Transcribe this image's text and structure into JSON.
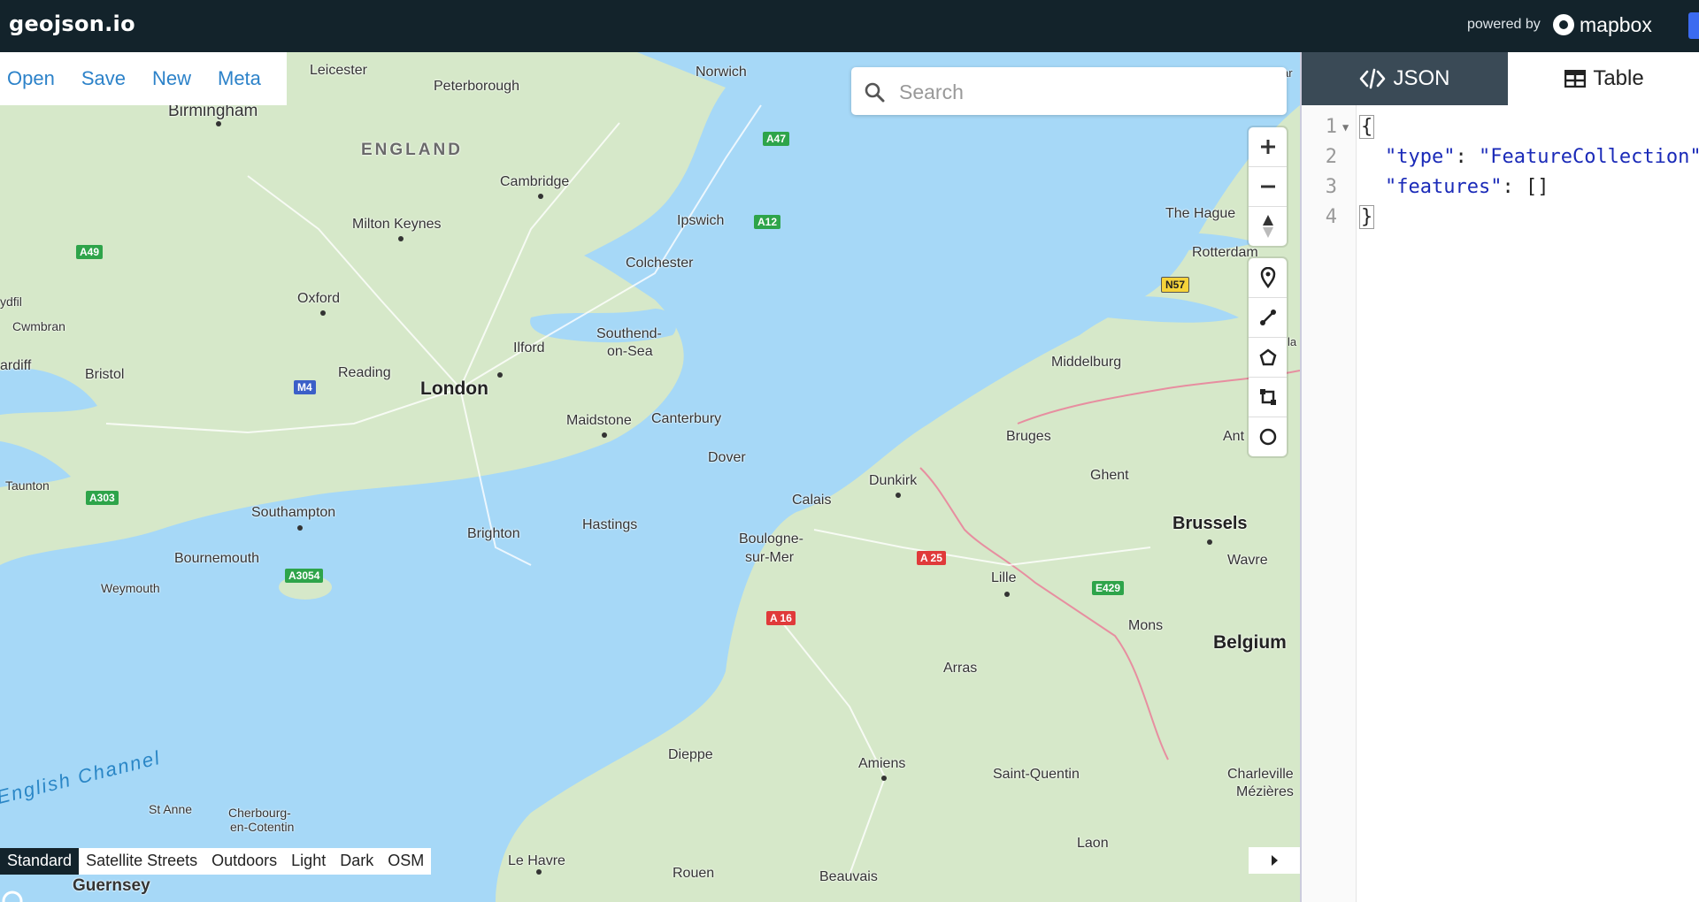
{
  "app": {
    "brand": "geojson.io",
    "powered_by": "powered by",
    "mapbox_label": "mapbox"
  },
  "file_menu": [
    "Open",
    "Save",
    "New",
    "Meta"
  ],
  "search": {
    "placeholder": "Search"
  },
  "map_labels": {
    "leicester": "Leicester",
    "peterborough": "Peterborough",
    "norwich": "Norwich",
    "birmingham": "Birmingham",
    "england": "ENGLAND",
    "cambridge": "Cambridge",
    "milton_keynes": "Milton Keynes",
    "ipswich": "Ipswich",
    "colchester": "Colchester",
    "oxford": "Oxford",
    "ydfil": "ydfil",
    "cwmbran": "Cwmbran",
    "cardiff": "ardiff",
    "bristol": "Bristol",
    "reading": "Reading",
    "london": "London",
    "ilford": "Ilford",
    "southend": "Southend-",
    "on_sea": "on-Sea",
    "maidstone": "Maidstone",
    "canterbury": "Canterbury",
    "dover": "Dover",
    "taunton": "Taunton",
    "southampton": "Southampton",
    "brighton": "Brighton",
    "hastings": "Hastings",
    "bournemouth": "Bournemouth",
    "weymouth": "Weymouth",
    "calais": "Calais",
    "boulogne": "Boulogne-",
    "sur_mer": "sur-Mer",
    "dunkirk": "Dunkirk",
    "bruges": "Bruges",
    "ghent": "Ghent",
    "brussels": "Brussels",
    "wavre": "Wavre",
    "lille": "Lille",
    "mons": "Mons",
    "belgium": "Belgium",
    "arras": "Arras",
    "the_hague": "The Hague",
    "rotterdam": "Rotterdam",
    "middelburg": "Middelburg",
    "ant": "Ant",
    "english_channel": "English Channel",
    "st_anne": "St Anne",
    "cherbourg": "Cherbourg-",
    "en_cotentin": "en-Cotentin",
    "guernsey": "Guernsey",
    "dieppe": "Dieppe",
    "amiens": "Amiens",
    "saint_quentin": "Saint-Quentin",
    "charleville": "Charleville",
    "mezieres": "Mézières",
    "laon": "Laon",
    "le_havre": "Le Havre",
    "rouen": "Rouen",
    "beauvais": "Beauvais",
    "ar": "ar",
    "la": "la"
  },
  "road_shields": {
    "a47": "A47",
    "a12": "A12",
    "a49": "A49",
    "m4": "M4",
    "a303": "A303",
    "a3054": "A3054",
    "a25": "A 25",
    "a16": "A 16",
    "e429": "E429",
    "n57": "N57"
  },
  "basemaps": [
    "Standard",
    "Satellite Streets",
    "Outdoors",
    "Light",
    "Dark",
    "OSM"
  ],
  "basemap_active": "Standard",
  "tabs": {
    "json": "JSON",
    "table": "Table"
  },
  "editor": {
    "line_numbers": [
      "1",
      "2",
      "3",
      "4"
    ],
    "open_brace": "{",
    "close_brace": "}",
    "type_key": "\"type\"",
    "type_value": "\"FeatureCollection\"",
    "features_key": "\"features\"",
    "features_value": "[]",
    "colon": ":",
    "comma": ","
  },
  "colors": {
    "topbar": "#13232b",
    "water": "#a6d8f7",
    "land": "#d6e8c9",
    "link": "#2c82c9",
    "json_key": "#1a2ab8"
  }
}
